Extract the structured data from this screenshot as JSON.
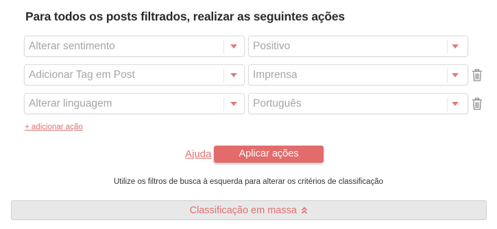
{
  "title": "Para todos os posts filtrados, realizar as seguintes ações",
  "actions": [
    {
      "action": "Alterar sentimento",
      "value": "Positivo",
      "deletable": false
    },
    {
      "action": "Adicionar Tag em Post",
      "value": "Imprensa",
      "deletable": true
    },
    {
      "action": "Alterar linguagem",
      "value": "Português",
      "deletable": true
    }
  ],
  "add_action_label": "+ adicionar ação",
  "help_label": "Ajuda",
  "apply_label": "Aplicar ações",
  "hint": "Utilize os filtros de busca à esquerda para alterar os critérios de classificação",
  "mass_label": "Classificação em massa",
  "icons": {
    "dropdown": "caret-down-icon",
    "delete": "trash-icon",
    "collapse": "double-chevron-up-icon"
  },
  "colors": {
    "accent": "#e26b6b",
    "link": "#e0706f",
    "placeholder": "#a5a5a5"
  }
}
